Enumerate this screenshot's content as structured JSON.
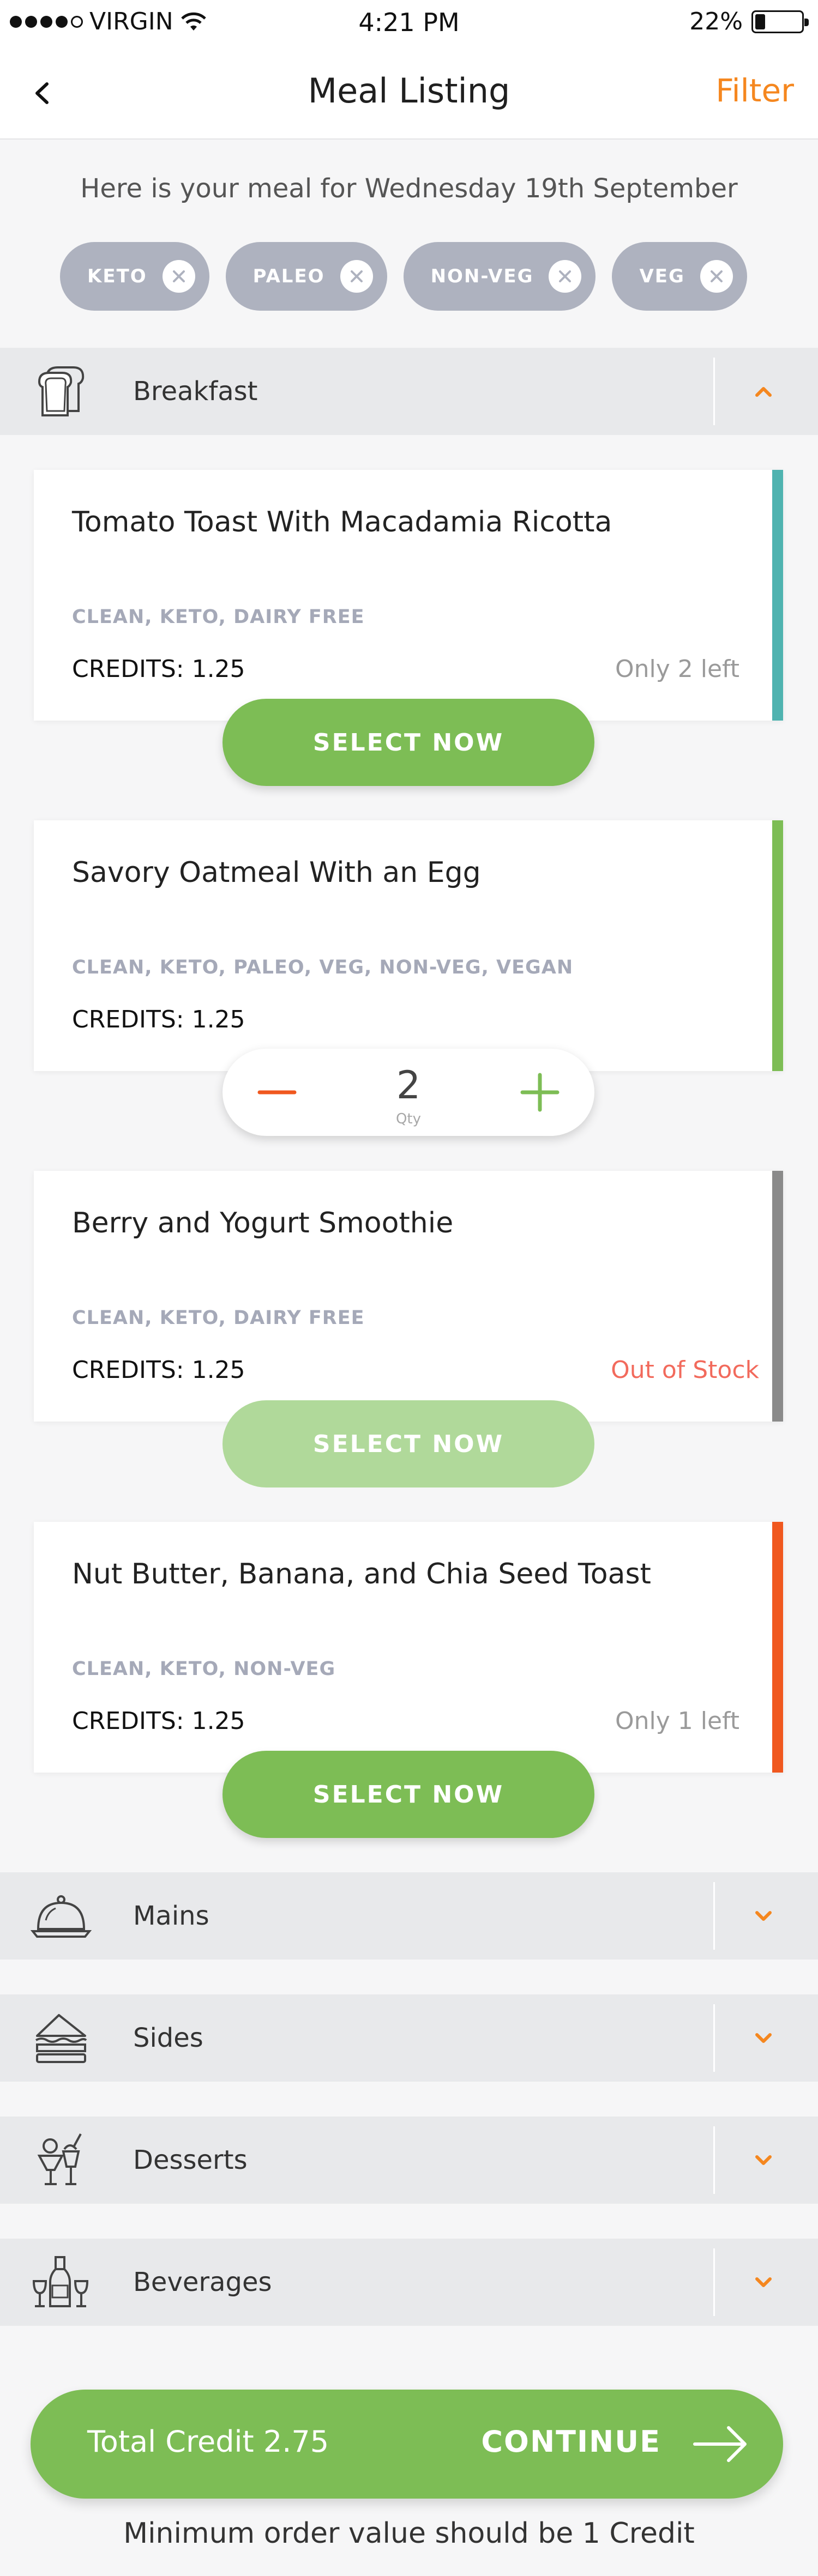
{
  "status_bar": {
    "carrier": "VIRGIN",
    "time": "4:21 PM",
    "battery_text": "22%",
    "battery_level": 0.22
  },
  "nav": {
    "title": "Meal Listing",
    "filter_label": "Filter"
  },
  "intro_text": "Here is your meal for Wednesday 19th September",
  "filter_chips": [
    {
      "label": "KETO"
    },
    {
      "label": "PALEO"
    },
    {
      "label": "NON-VEG"
    },
    {
      "label": "VEG"
    }
  ],
  "categories": {
    "breakfast": {
      "label": "Breakfast",
      "icon": "toast-icon",
      "expanded": true
    },
    "mains": {
      "label": "Mains",
      "icon": "cloche-icon",
      "expanded": false
    },
    "sides": {
      "label": "Sides",
      "icon": "sandwich-icon",
      "expanded": false
    },
    "desserts": {
      "label": "Desserts",
      "icon": "dessert-icon",
      "expanded": false
    },
    "beverages": {
      "label": "Beverages",
      "icon": "wine-bottle-icon",
      "expanded": false
    }
  },
  "meals": [
    {
      "title": "Tomato Toast With Macadamia Ricotta",
      "tags": "CLEAN, KETO, DAIRY FREE",
      "credits": "CREDITS: 1.25",
      "stock": "Only 2 left",
      "accent": "#4fb3b0",
      "action": "SELECT NOW"
    },
    {
      "title": "Savory Oatmeal With an Egg",
      "tags": "CLEAN, KETO, PALEO, VEG, NON-VEG, VEGAN",
      "credits": "CREDITS: 1.25",
      "stock": "",
      "accent": "#7dbd55",
      "quantity": "2",
      "quantity_unit": "Qty"
    },
    {
      "title": "Berry and Yogurt Smoothie",
      "tags": "CLEAN, KETO, DAIRY FREE",
      "credits": "CREDITS: 1.25",
      "stock": "Out of Stock",
      "accent": "#8a8a8a",
      "action": "SELECT NOW"
    },
    {
      "title": "Nut Butter, Banana, and Chia Seed Toast",
      "tags": "CLEAN, KETO, NON-VEG",
      "credits": "CREDITS: 1.25",
      "stock": "Only 1 left",
      "accent": "#f0581f",
      "action": "SELECT NOW"
    }
  ],
  "footer": {
    "total_credit": "Total Credit 2.75",
    "continue_label": "CONTINUE",
    "min_order_note": "Minimum order value should be 1 Credit"
  },
  "colors": {
    "accent_orange": "#f5871f",
    "primary_green": "#7dbd55",
    "chip_grey": "#aeb2bf"
  }
}
